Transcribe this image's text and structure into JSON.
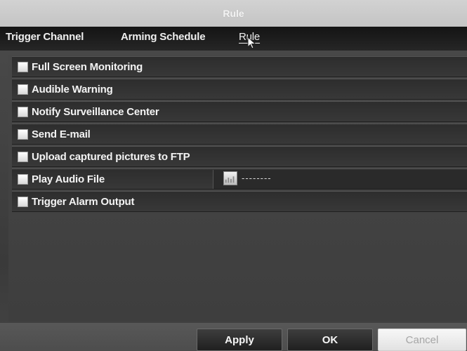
{
  "window": {
    "title": "Rule"
  },
  "tabs": [
    {
      "label": "Trigger Channel",
      "active": false
    },
    {
      "label": "Arming Schedule",
      "active": false
    },
    {
      "label": "Rule",
      "active": true
    }
  ],
  "rules": [
    {
      "label": "Full Screen Monitoring",
      "checked": false
    },
    {
      "label": "Audible Warning",
      "checked": false
    },
    {
      "label": "Notify Surveillance Center",
      "checked": false
    },
    {
      "label": "Send E-mail",
      "checked": false
    },
    {
      "label": "Upload captured pictures to FTP",
      "checked": false
    },
    {
      "label": "Play Audio File",
      "checked": false,
      "audio_value": "--------"
    },
    {
      "label": "Trigger Alarm Output",
      "checked": false
    }
  ],
  "buttons": {
    "apply": "Apply",
    "ok": "OK",
    "cancel": "Cancel"
  },
  "icons": {
    "audio_file": "audio-file-icon",
    "cursor": "mouse-pointer-icon"
  }
}
